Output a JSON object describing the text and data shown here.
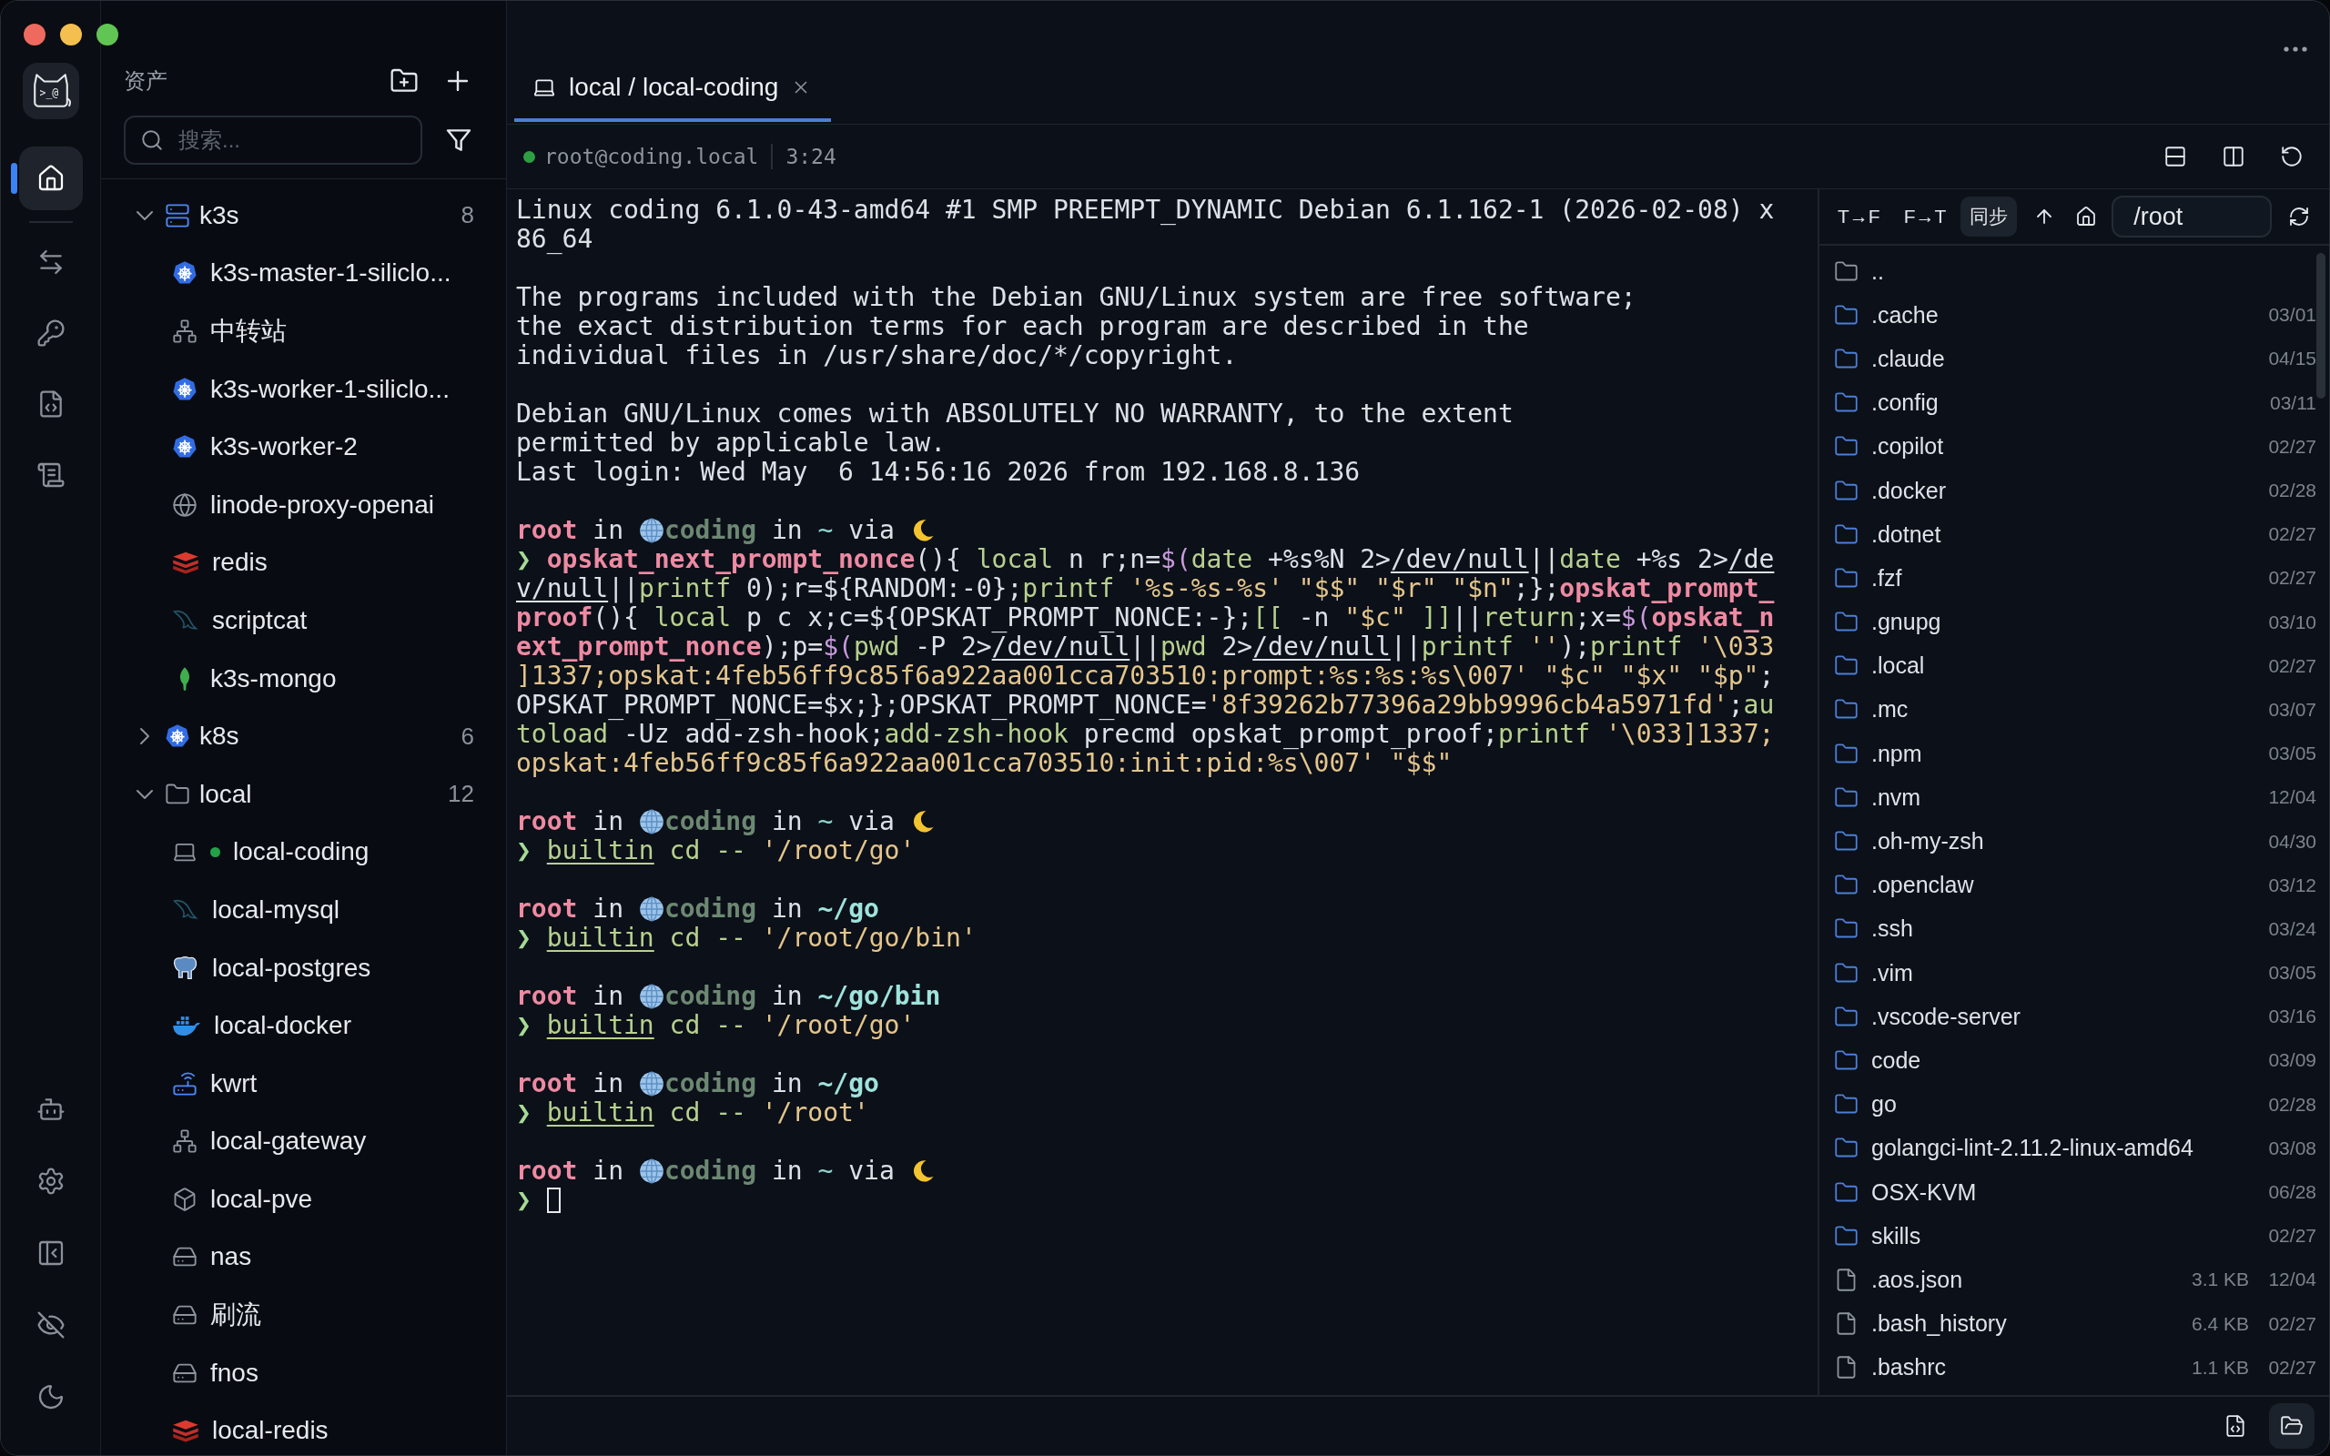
{
  "app": {
    "logo_text": ">_@"
  },
  "rail": {
    "nav": [
      {
        "kind": "home",
        "selected": true
      },
      {
        "kind": "transfer",
        "selected": false
      },
      {
        "kind": "keys",
        "selected": false
      },
      {
        "kind": "snippets",
        "selected": false
      },
      {
        "kind": "logs",
        "selected": false
      }
    ],
    "tools": [
      {
        "kind": "assistant"
      },
      {
        "kind": "settings"
      },
      {
        "kind": "collapse"
      },
      {
        "kind": "privacy"
      },
      {
        "kind": "theme"
      }
    ]
  },
  "sidebar": {
    "title": "资产",
    "search": {
      "placeholder": "搜索..."
    },
    "tree": [
      {
        "name": "k3s",
        "kind": "server-group",
        "count": "8",
        "expanded": true,
        "children": [
          {
            "name": "k3s-master-1-siliclo...",
            "kind": "kubernetes",
            "connected": false
          },
          {
            "name": "中转站",
            "kind": "network",
            "connected": false
          },
          {
            "name": "k3s-worker-1-siliclo...",
            "kind": "kubernetes",
            "connected": false
          },
          {
            "name": "k3s-worker-2",
            "kind": "kubernetes",
            "connected": false
          },
          {
            "name": "linode-proxy-openai",
            "kind": "web",
            "connected": false
          },
          {
            "name": "redis",
            "kind": "redis",
            "connected": false
          },
          {
            "name": "scriptcat",
            "kind": "mysql",
            "connected": false
          },
          {
            "name": "k3s-mongo",
            "kind": "mongo",
            "connected": false
          }
        ]
      },
      {
        "name": "k8s",
        "kind": "kubernetes",
        "count": "6",
        "expanded": false
      },
      {
        "name": "local",
        "kind": "folder",
        "count": "12",
        "expanded": true,
        "children": [
          {
            "name": "local-coding",
            "kind": "laptop",
            "connected": true
          },
          {
            "name": "local-mysql",
            "kind": "mysql",
            "connected": false
          },
          {
            "name": "local-postgres",
            "kind": "postgres",
            "connected": false
          },
          {
            "name": "local-docker",
            "kind": "docker",
            "connected": false
          },
          {
            "name": "kwrt",
            "kind": "router",
            "connected": false
          },
          {
            "name": "local-gateway",
            "kind": "network",
            "connected": false
          },
          {
            "name": "local-pve",
            "kind": "vm",
            "connected": false
          },
          {
            "name": "nas",
            "kind": "storage",
            "connected": false
          },
          {
            "name": "刷流",
            "kind": "storage",
            "connected": false
          },
          {
            "name": "fnos",
            "kind": "storage",
            "connected": false
          },
          {
            "name": "local-redis",
            "kind": "redis",
            "connected": false
          }
        ]
      }
    ]
  },
  "tabs": [
    {
      "label": "local / local-coding",
      "selected": true
    }
  ],
  "session": {
    "connected": true,
    "host": "root@coding.local",
    "time": "3:24"
  },
  "terminal": {
    "blocks": [
      {
        "lines": [
          {
            "text": "Linux coding 6.1.0-43-amd64 #1 SMP PREEMPT_DYNAMIC Debian 6.1.162-1 (2026-02-08) x"
          },
          {
            "text": "86_64"
          }
        ]
      },
      {
        "lines": [
          {
            "text": "The programs included with the Debian GNU/Linux system are free software;"
          },
          {
            "text": "the exact distribution terms for each program are described in the"
          },
          {
            "text": "individual files in /usr/share/doc/*/copyright."
          }
        ]
      },
      {
        "lines": [
          {
            "text": "Debian GNU/Linux comes with ABSOLUTELY NO WARRANTY, to the extent"
          },
          {
            "text": "permitted by applicable law."
          },
          {
            "text": "Last login: Wed May  6 14:56:16 2026 from 192.168.8.136"
          }
        ]
      },
      {
        "lines": [
          {
            "segments": [
              {
                "kind": "user",
                "text": "root"
              },
              {
                "kind": "plain",
                "text": " in "
              },
              {
                "kind": "globe"
              },
              {
                "kind": "host",
                "text": "coding"
              },
              {
                "kind": "plain",
                "text": " in "
              },
              {
                "kind": "dir",
                "text": "~"
              },
              {
                "kind": "plain",
                "text": " via "
              },
              {
                "kind": "moon"
              }
            ]
          },
          {
            "segments": [
              {
                "kind": "arrow",
                "text": "❯ "
              },
              {
                "kind": "func",
                "text": "opskat_next_prompt_nonce"
              },
              {
                "kind": "plain",
                "text": "(){ "
              },
              {
                "kind": "kw",
                "text": "local"
              },
              {
                "kind": "plain",
                "text": " n r;n="
              },
              {
                "kind": "sub",
                "text": "$("
              },
              {
                "kind": "kw",
                "text": "date"
              },
              {
                "kind": "plain",
                "text": " +%s%N 2>"
              },
              {
                "kind": "path",
                "text": "/dev/null"
              },
              {
                "kind": "plain",
                "text": "||"
              },
              {
                "kind": "kw",
                "text": "date"
              },
              {
                "kind": "plain",
                "text": " +%s 2>"
              },
              {
                "kind": "path",
                "text": "/de"
              }
            ]
          },
          {
            "segments": [
              {
                "kind": "path",
                "text": "v/null"
              },
              {
                "kind": "plain",
                "text": "||"
              },
              {
                "kind": "kw",
                "text": "printf"
              },
              {
                "kind": "plain",
                "text": " 0);r=${RANDOM:-0};"
              },
              {
                "kind": "kw",
                "text": "printf"
              },
              {
                "kind": "str",
                "text": " '%s-%s-%s' \"$$\" \"$r\" \"$n\""
              },
              {
                "kind": "plain",
                "text": ";};"
              },
              {
                "kind": "func",
                "text": "opskat_prompt_"
              }
            ]
          },
          {
            "segments": [
              {
                "kind": "func",
                "text": "proof"
              },
              {
                "kind": "plain",
                "text": "(){ "
              },
              {
                "kind": "kw",
                "text": "local"
              },
              {
                "kind": "plain",
                "text": " p c x;c=${OPSKAT_PROMPT_NONCE:-};"
              },
              {
                "kind": "kw",
                "text": "[["
              },
              {
                "kind": "plain",
                "text": " -n "
              },
              {
                "kind": "str",
                "text": "\"$c\" "
              },
              {
                "kind": "kw",
                "text": "]]"
              },
              {
                "kind": "plain",
                "text": "||"
              },
              {
                "kind": "kw",
                "text": "return"
              },
              {
                "kind": "plain",
                "text": ";x="
              },
              {
                "kind": "sub",
                "text": "$("
              },
              {
                "kind": "func",
                "text": "opskat_n"
              }
            ]
          },
          {
            "segments": [
              {
                "kind": "func",
                "text": "ext_prompt_nonce"
              },
              {
                "kind": "plain",
                "text": ");p="
              },
              {
                "kind": "sub",
                "text": "$("
              },
              {
                "kind": "kw",
                "text": "pwd"
              },
              {
                "kind": "plain",
                "text": " -P 2>"
              },
              {
                "kind": "path",
                "text": "/dev/null"
              },
              {
                "kind": "plain",
                "text": "||"
              },
              {
                "kind": "kw",
                "text": "pwd"
              },
              {
                "kind": "plain",
                "text": " 2>"
              },
              {
                "kind": "path",
                "text": "/dev/null"
              },
              {
                "kind": "plain",
                "text": "||"
              },
              {
                "kind": "kw",
                "text": "printf"
              },
              {
                "kind": "str",
                "text": " ''"
              },
              {
                "kind": "plain",
                "text": ");"
              },
              {
                "kind": "kw",
                "text": "printf"
              },
              {
                "kind": "str",
                "text": " '\\033"
              }
            ]
          },
          {
            "segments": [
              {
                "kind": "str",
                "text": "]1337;opskat:4feb56ff9c85f6a922aa001cca703510:prompt:%s:%s:%s\\007' \"$c\" \"$x\" \"$p\""
              },
              {
                "kind": "plain",
                "text": ";"
              }
            ]
          },
          {
            "segments": [
              {
                "kind": "plain",
                "text": "OPSKAT_PROMPT_NONCE=$x;};OPSKAT_PROMPT_NONCE="
              },
              {
                "kind": "str",
                "text": "'8f39262b77396a29bb9996cb4a5971fd'"
              },
              {
                "kind": "plain",
                "text": ";"
              },
              {
                "kind": "kw",
                "text": "au"
              }
            ]
          },
          {
            "segments": [
              {
                "kind": "kw",
                "text": "toload"
              },
              {
                "kind": "plain",
                "text": " -Uz add-zsh-hook;"
              },
              {
                "kind": "kw",
                "text": "add-zsh-hook"
              },
              {
                "kind": "plain",
                "text": " precmd opskat_prompt_proof;"
              },
              {
                "kind": "kw",
                "text": "printf"
              },
              {
                "kind": "str",
                "text": " '\\033]1337;"
              }
            ]
          },
          {
            "segments": [
              {
                "kind": "str",
                "text": "opskat:4feb56ff9c85f6a922aa001cca703510:init:pid:%s\\007' \"$$\""
              }
            ]
          }
        ]
      },
      {
        "lines": [
          {
            "segments": [
              {
                "kind": "user",
                "text": "root"
              },
              {
                "kind": "plain",
                "text": " in "
              },
              {
                "kind": "globe"
              },
              {
                "kind": "host",
                "text": "coding"
              },
              {
                "kind": "plain",
                "text": " in "
              },
              {
                "kind": "dir",
                "text": "~"
              },
              {
                "kind": "plain",
                "text": " via "
              },
              {
                "kind": "moon"
              }
            ]
          },
          {
            "segments": [
              {
                "kind": "arrow",
                "text": "❯ "
              },
              {
                "kind": "builtin",
                "text": "builtin"
              },
              {
                "kind": "kw",
                "text": " cd -- "
              },
              {
                "kind": "str",
                "text": "'/root/go'"
              }
            ]
          }
        ]
      },
      {
        "lines": [
          {
            "segments": [
              {
                "kind": "user",
                "text": "root"
              },
              {
                "kind": "plain",
                "text": " in "
              },
              {
                "kind": "globe"
              },
              {
                "kind": "host",
                "text": "coding"
              },
              {
                "kind": "plain",
                "text": " in "
              },
              {
                "kind": "dirbold",
                "text": "~/go"
              }
            ]
          },
          {
            "segments": [
              {
                "kind": "arrow",
                "text": "❯ "
              },
              {
                "kind": "builtin",
                "text": "builtin"
              },
              {
                "kind": "kw",
                "text": " cd -- "
              },
              {
                "kind": "str",
                "text": "'/root/go/bin'"
              }
            ]
          }
        ]
      },
      {
        "lines": [
          {
            "segments": [
              {
                "kind": "user",
                "text": "root"
              },
              {
                "kind": "plain",
                "text": " in "
              },
              {
                "kind": "globe"
              },
              {
                "kind": "host",
                "text": "coding"
              },
              {
                "kind": "plain",
                "text": " in "
              },
              {
                "kind": "dirbold",
                "text": "~/go/bin"
              }
            ]
          },
          {
            "segments": [
              {
                "kind": "arrow",
                "text": "❯ "
              },
              {
                "kind": "builtin",
                "text": "builtin"
              },
              {
                "kind": "kw",
                "text": " cd -- "
              },
              {
                "kind": "str",
                "text": "'/root/go'"
              }
            ]
          }
        ]
      },
      {
        "lines": [
          {
            "segments": [
              {
                "kind": "user",
                "text": "root"
              },
              {
                "kind": "plain",
                "text": " in "
              },
              {
                "kind": "globe"
              },
              {
                "kind": "host",
                "text": "coding"
              },
              {
                "kind": "plain",
                "text": " in "
              },
              {
                "kind": "dirbold",
                "text": "~/go"
              }
            ]
          },
          {
            "segments": [
              {
                "kind": "arrow",
                "text": "❯ "
              },
              {
                "kind": "builtin",
                "text": "builtin"
              },
              {
                "kind": "kw",
                "text": " cd -- "
              },
              {
                "kind": "str",
                "text": "'/root'"
              }
            ]
          }
        ]
      },
      {
        "lines": [
          {
            "segments": [
              {
                "kind": "user",
                "text": "root"
              },
              {
                "kind": "plain",
                "text": " in "
              },
              {
                "kind": "globe"
              },
              {
                "kind": "host",
                "text": "coding"
              },
              {
                "kind": "plain",
                "text": " in "
              },
              {
                "kind": "dir",
                "text": "~"
              },
              {
                "kind": "plain",
                "text": " via "
              },
              {
                "kind": "moon"
              }
            ]
          },
          {
            "segments": [
              {
                "kind": "arrow",
                "text": "❯ "
              },
              {
                "kind": "cursor"
              }
            ]
          }
        ]
      }
    ]
  },
  "files": {
    "modes": [
      {
        "label": "T→F",
        "selected": false
      },
      {
        "label": "F→T",
        "selected": false
      },
      {
        "label": "同步",
        "selected": true
      }
    ],
    "path": "/root",
    "entries": [
      {
        "kind": "parent",
        "name": ".."
      },
      {
        "kind": "folder",
        "name": ".cache",
        "date": "03/01"
      },
      {
        "kind": "folder",
        "name": ".claude",
        "date": "04/15"
      },
      {
        "kind": "folder",
        "name": ".config",
        "date": "03/11"
      },
      {
        "kind": "folder",
        "name": ".copilot",
        "date": "02/27"
      },
      {
        "kind": "folder",
        "name": ".docker",
        "date": "02/28"
      },
      {
        "kind": "folder",
        "name": ".dotnet",
        "date": "02/27"
      },
      {
        "kind": "folder",
        "name": ".fzf",
        "date": "02/27"
      },
      {
        "kind": "folder",
        "name": ".gnupg",
        "date": "03/10"
      },
      {
        "kind": "folder",
        "name": ".local",
        "date": "02/27"
      },
      {
        "kind": "folder",
        "name": ".mc",
        "date": "03/07"
      },
      {
        "kind": "folder",
        "name": ".npm",
        "date": "03/05"
      },
      {
        "kind": "folder",
        "name": ".nvm",
        "date": "12/04"
      },
      {
        "kind": "folder",
        "name": ".oh-my-zsh",
        "date": "04/30"
      },
      {
        "kind": "folder",
        "name": ".openclaw",
        "date": "03/12"
      },
      {
        "kind": "folder",
        "name": ".ssh",
        "date": "03/24"
      },
      {
        "kind": "folder",
        "name": ".vim",
        "date": "03/05"
      },
      {
        "kind": "folder",
        "name": ".vscode-server",
        "date": "03/16"
      },
      {
        "kind": "folder",
        "name": "code",
        "date": "03/09"
      },
      {
        "kind": "folder",
        "name": "go",
        "date": "02/28"
      },
      {
        "kind": "folder",
        "name": "golangci-lint-2.11.2-linux-amd64",
        "date": "03/08"
      },
      {
        "kind": "folder",
        "name": "OSX-KVM",
        "date": "06/28"
      },
      {
        "kind": "folder",
        "name": "skills",
        "date": "02/27"
      },
      {
        "kind": "file",
        "name": ".aos.json",
        "size": "3.1 KB",
        "date": "12/04"
      },
      {
        "kind": "file",
        "name": ".bash_history",
        "size": "6.4 KB",
        "date": "02/27"
      },
      {
        "kind": "file",
        "name": ".bashrc",
        "size": "1.1 KB",
        "date": "02/27"
      }
    ]
  },
  "footer": {
    "views": [
      {
        "kind": "code",
        "selected": false
      },
      {
        "kind": "files",
        "selected": true
      }
    ]
  }
}
